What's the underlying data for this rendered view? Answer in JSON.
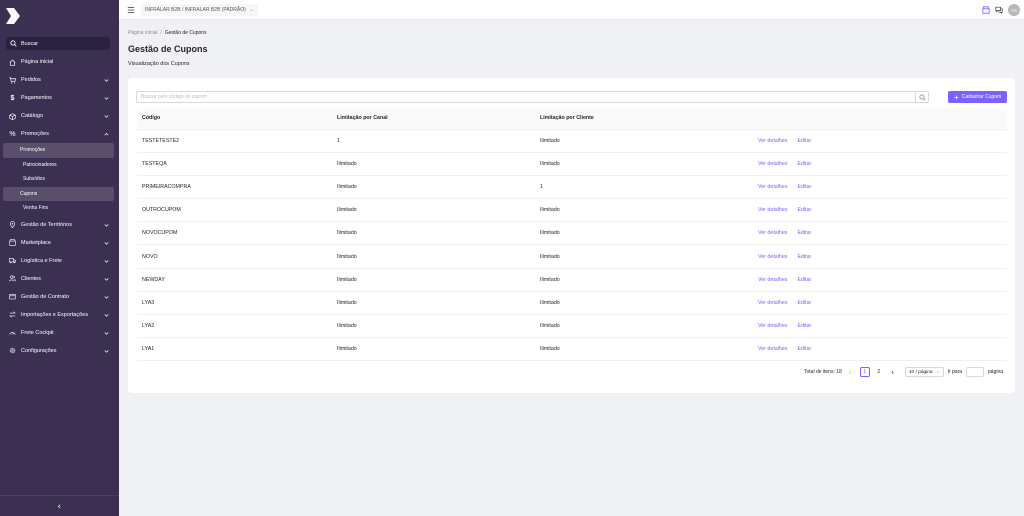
{
  "colors": {
    "sidebar": "#3b2f52",
    "accent": "#7b61ff",
    "active_item": "#5a4f6b"
  },
  "sidebar": {
    "search_placeholder": "Buscar",
    "items": [
      {
        "label": "Página inicial",
        "icon": "home-icon"
      },
      {
        "label": "Pedidos",
        "icon": "cart-icon"
      },
      {
        "label": "Pagamentos",
        "icon": "dollar-icon"
      },
      {
        "label": "Catálogo",
        "icon": "box-icon"
      },
      {
        "label": "Promoções",
        "icon": "percent-icon"
      }
    ],
    "promo_sub": [
      "Promoções",
      "Patrocinadores",
      "Subsídios",
      "Cupons",
      "Venha Fins"
    ],
    "items_after": [
      {
        "label": "Gestão de Territórios",
        "icon": "pin-icon"
      },
      {
        "label": "Marketplace",
        "icon": "store-icon"
      },
      {
        "label": "Logística e Frete",
        "icon": "truck-icon"
      },
      {
        "label": "Clientes",
        "icon": "users-icon"
      },
      {
        "label": "Gestão de Contrato",
        "icon": "contract-icon"
      },
      {
        "label": "Importações e Exportações",
        "icon": "transfer-icon"
      },
      {
        "label": "Frete Cockpit",
        "icon": "cockpit-icon"
      },
      {
        "label": "Configurações",
        "icon": "gear-icon"
      }
    ]
  },
  "header": {
    "org": "INFRALAR B2B / INFRALAR B2B (PADRÃO)",
    "avatar_initials": "AS"
  },
  "breadcrumb": {
    "home": "Página inicial",
    "sep": "/",
    "current": "Gestão de Cupons"
  },
  "page": {
    "title": "Gestão de Cupons",
    "subtitle": "Visualização dos Cupons"
  },
  "toolbar": {
    "search_placeholder": "Buscar pelo código do cupom",
    "add_label": "Cadastrar Cupom"
  },
  "table": {
    "headers": [
      "Código",
      "Limitação por Canal",
      "Limitação por Cliente"
    ],
    "actions": {
      "details": "Ver detalhes",
      "edit": "Editar"
    },
    "rows": [
      [
        "TESTETESTE2",
        "1",
        "Ilimitado"
      ],
      [
        "TESTEQA",
        "Ilimitado",
        "Ilimitado"
      ],
      [
        "PRIMEIRACOMPRA",
        "Ilimitado",
        "1"
      ],
      [
        "OUTROCUPOM",
        "Ilimitado",
        "Ilimitado"
      ],
      [
        "NOVOCUPOM",
        "Ilimitado",
        "Ilimitado"
      ],
      [
        "NOVO",
        "Ilimitado",
        "Ilimitado"
      ],
      [
        "NEWDAY",
        "Ilimitado",
        "Ilimitado"
      ],
      [
        "LYA3",
        "Ilimitado",
        "Ilimitado"
      ],
      [
        "LYA2",
        "Ilimitado",
        "Ilimitado"
      ],
      [
        "LYA1",
        "Ilimitado",
        "Ilimitado"
      ]
    ]
  },
  "pagination": {
    "total": "Total de itens: 18",
    "pages": [
      "1",
      "2"
    ],
    "page_size": "10 / página",
    "goto_label": "Ir para",
    "goto_suffix": "página"
  }
}
